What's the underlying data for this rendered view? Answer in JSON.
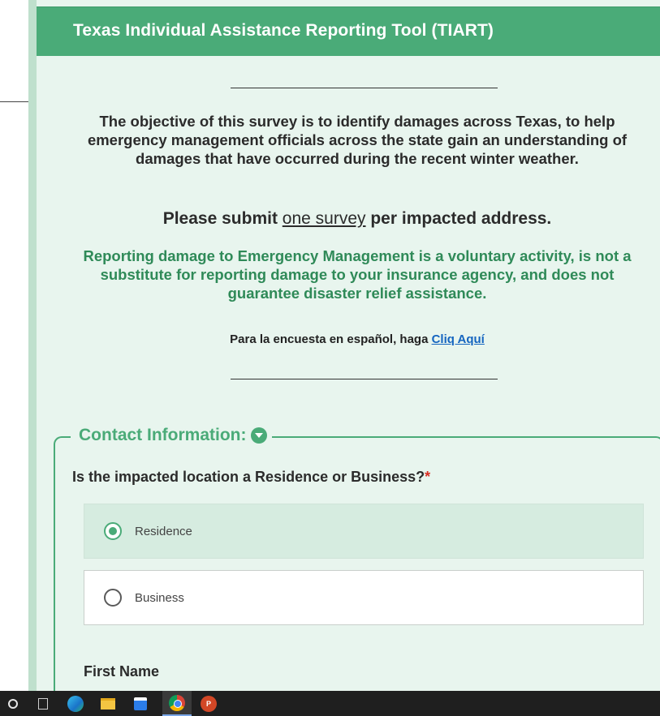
{
  "header": {
    "title": "Texas Individual Assistance Reporting Tool (TIART)"
  },
  "intro": {
    "objective": "The objective of this survey is to identify damages across Texas, to help emergency management officials across the state gain an understanding of damages that have occurred during the recent winter weather.",
    "submit_prefix": "Please submit ",
    "submit_link": "one survey",
    "submit_suffix": " per impacted address.",
    "disclaimer": "Reporting damage to Emergency Management is a voluntary activity, is not a substitute for reporting damage to your insurance agency, and does not guarantee disaster relief assistance.",
    "spanish_prefix": "Para la encuesta en español, haga ",
    "spanish_link": "Cliq Aquí"
  },
  "contact": {
    "legend": "Contact Information:",
    "question": "Is the impacted location a Residence or Business?",
    "required_mark": "*",
    "options": [
      {
        "label": "Residence",
        "selected": true
      },
      {
        "label": "Business",
        "selected": false
      }
    ],
    "first_name_label": "First Name"
  },
  "taskbar": {
    "icons": [
      "search-icon",
      "task-view-icon",
      "edge-icon",
      "file-explorer-icon",
      "store-icon",
      "chrome-icon",
      "powerpoint-icon"
    ],
    "ppt_letter": "P"
  },
  "colors": {
    "accent": "#4aab78",
    "background": "#e8f5ee",
    "link": "#1565c0",
    "required": "#d93025"
  }
}
